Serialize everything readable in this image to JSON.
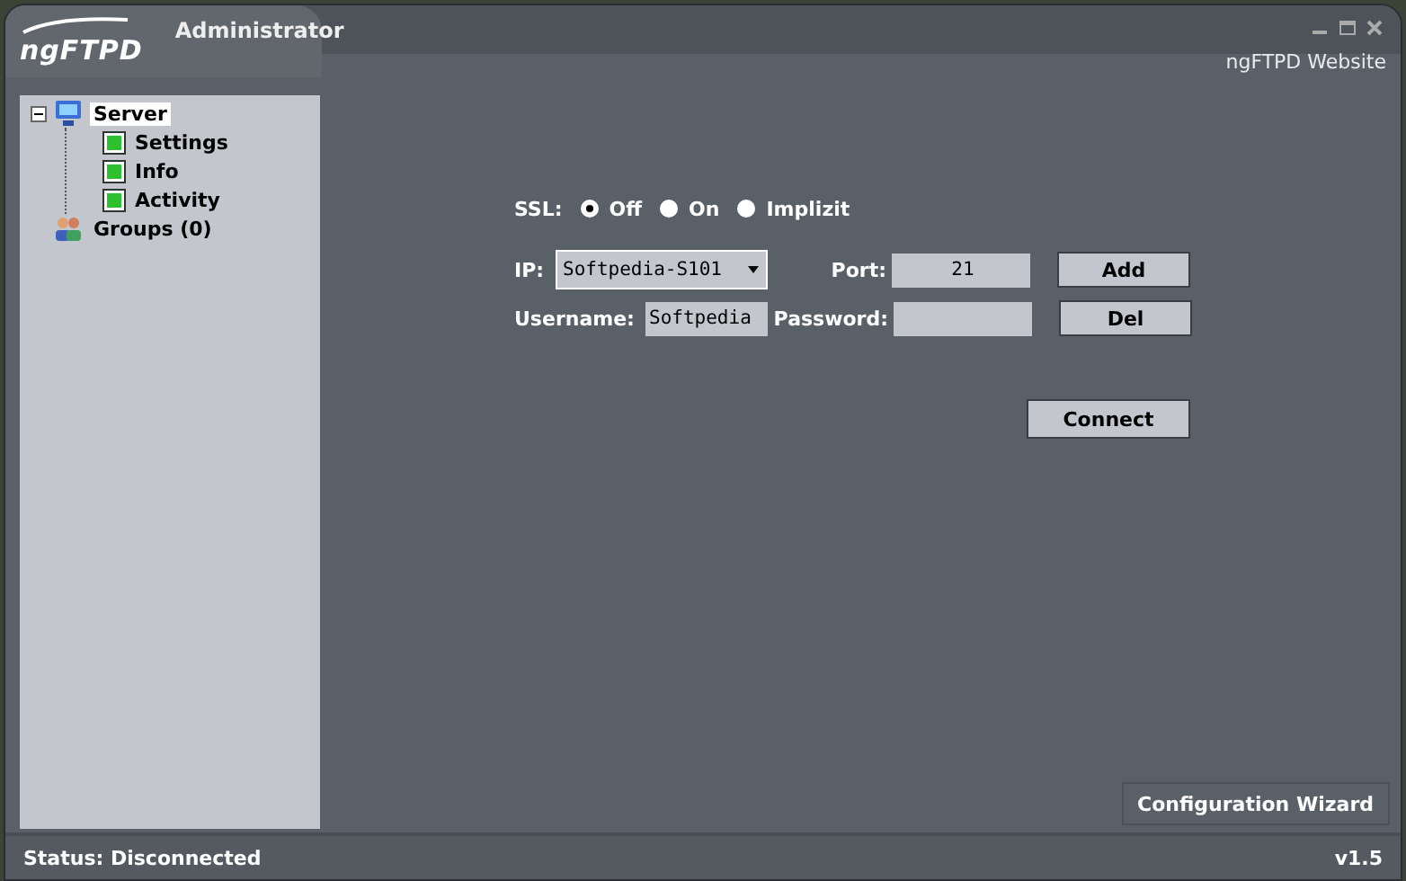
{
  "window": {
    "logo": "ngFTPD",
    "title": "Administrator"
  },
  "website_link": "ngFTPD Website",
  "tree": [
    {
      "label": "Server",
      "kind": "server",
      "selected": true,
      "expanded": true,
      "children": [
        {
          "label": "Settings",
          "kind": "leaf",
          "selected": false
        },
        {
          "label": "Info",
          "kind": "leaf",
          "selected": false
        },
        {
          "label": "Activity",
          "kind": "leaf",
          "selected": false
        }
      ]
    },
    {
      "label": "Groups (0)",
      "kind": "groups",
      "selected": false
    }
  ],
  "ssl": {
    "label": "SSL:",
    "options": [
      {
        "label": "Off",
        "selected": true
      },
      {
        "label": "On",
        "selected": false
      },
      {
        "label": "Implizit",
        "selected": false
      }
    ]
  },
  "ip": {
    "label": "IP:",
    "value": "Softpedia-S101"
  },
  "port": {
    "label": "Port:",
    "value": "21"
  },
  "username": {
    "label": "Username:",
    "value": "Softpedia"
  },
  "password": {
    "label": "Password:"
  },
  "buttons": {
    "add": "Add",
    "del": "Del",
    "connect": "Connect",
    "wizard": "Configuration Wizard"
  },
  "status_bar": {
    "status": "Status: Disconnected",
    "version": "v1.5"
  }
}
